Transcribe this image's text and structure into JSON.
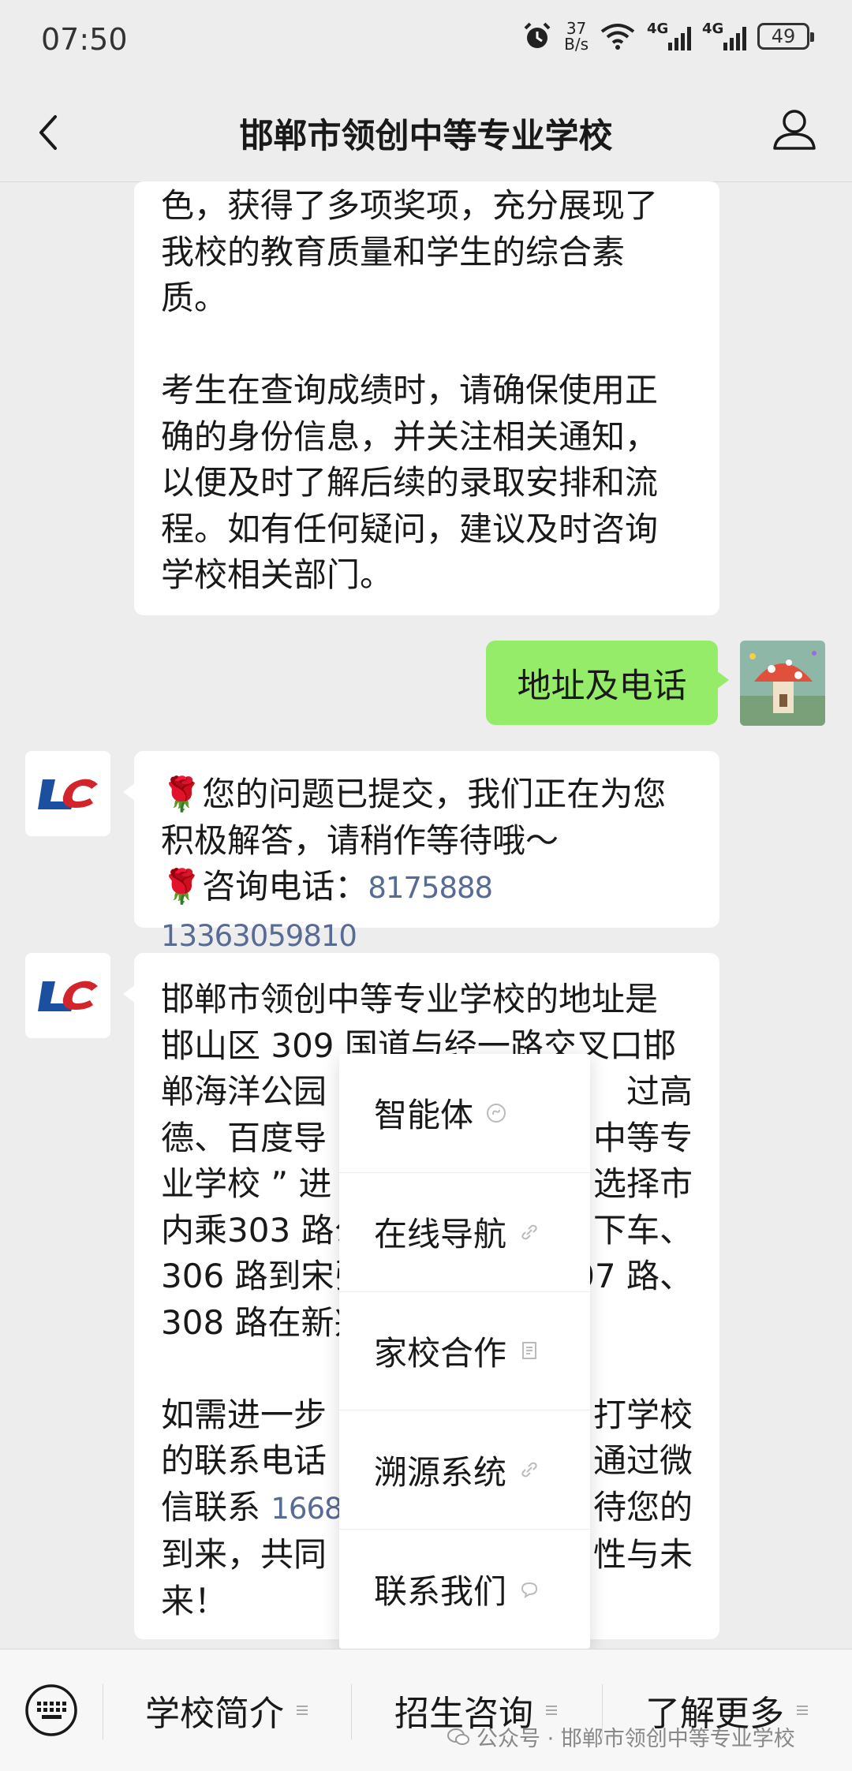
{
  "status_bar": {
    "time": "07:50",
    "net_speed_value": "37",
    "net_speed_unit": "B/s",
    "signal1_label": "4G",
    "signal2_label": "4G",
    "battery_level": "49",
    "icons": [
      "alarm-icon",
      "wifi-icon",
      "signal-icon",
      "battery-icon"
    ]
  },
  "nav": {
    "title": "邯郸市领创中等专业学校",
    "back_icon": "chevron-left-icon",
    "profile_icon": "person-icon"
  },
  "messages": {
    "m1": {
      "p1": [
        "色，获得了多项奖项，充分展现了",
        "我校的教育质量和学生的综合素",
        "质。"
      ],
      "p2": [
        "考生在查询成绩时，请确保使用正",
        "确的身份信息，并关注相关通知，",
        "以便及时了解后续的录取安排和流",
        "程。如有任何疑问，建议及时咨询",
        "学校相关部门。"
      ]
    },
    "m2_user": "地址及电话",
    "m3": {
      "flower_icon": "🌹",
      "line1": "您的问题已提交，我们正在为您",
      "line2": "积极解答，请稍作等待哦～",
      "line3_label": "咨询电话：",
      "phones": "8175888 13363059810"
    },
    "m4": {
      "lines": [
        "邯郸市领创中等专业学校的地址是",
        "邯山区 309 国道与经一路交叉口邯",
        "郸海洋公园",
        "德、百度导",
        "业学校 ” 进",
        "内乘303 路公",
        "306 路到宋张",
        "308 路在新兴"
      ],
      "right_lines": [
        "过高",
        "中等专",
        "选择市",
        "下车、",
        "307 路、"
      ],
      "p2_lines": [
        "如需进一步",
        "的联系电话",
        "信联系",
        "到来，共同",
        "来！"
      ],
      "p2_right": [
        "打学校",
        "通过微",
        "待您的",
        "性与未"
      ],
      "partial_phone": "16682"
    }
  },
  "popup_menu": {
    "items": [
      {
        "label": "智能体",
        "icon": "mini-program-icon"
      },
      {
        "label": "在线导航",
        "icon": "link-icon"
      },
      {
        "label": "家校合作",
        "icon": "article-icon"
      },
      {
        "label": "溯源系统",
        "icon": "link-icon"
      },
      {
        "label": "联系我们",
        "icon": "chat-icon"
      }
    ]
  },
  "bottom_menu": {
    "keyboard_icon": "keyboard-icon",
    "items": [
      "学校简介",
      "招生咨询",
      "了解更多"
    ]
  },
  "watermark": "公众号 · 邯郸市领创中等专业学校",
  "colors": {
    "background": "#ededed",
    "user_bubble": "#95ec69",
    "link": "#576b95",
    "logo_blue": "#1d4fa0",
    "logo_red": "#d3242b"
  }
}
